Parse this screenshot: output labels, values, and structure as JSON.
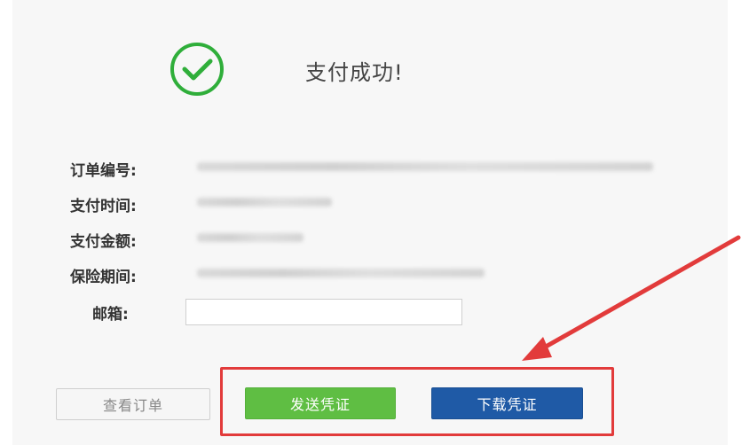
{
  "success": {
    "icon": "check-circle-icon",
    "text": "支付成功!",
    "color": "#2fae3a"
  },
  "order": {
    "fields": [
      {
        "label": "订单编号:",
        "value_redacted": true
      },
      {
        "label": "支付时间:",
        "value_redacted": true
      },
      {
        "label": "支付金额:",
        "value_redacted": true
      },
      {
        "label": "保险期间:",
        "value_redacted": true
      }
    ]
  },
  "email": {
    "label": "邮箱:",
    "value": "",
    "placeholder": ""
  },
  "buttons": {
    "view_order": "查看订单",
    "send_voucher": "发送凭证",
    "download_voucher": "下载凭证"
  },
  "annotation": {
    "highlight_color": "#e23b3b",
    "arrow": "arrow-pointer-icon"
  }
}
